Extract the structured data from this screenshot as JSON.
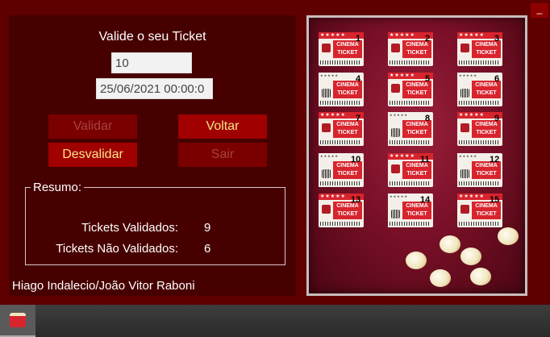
{
  "window": {
    "minimize_label": "_"
  },
  "form": {
    "title": "Valide o seu Ticket",
    "ticket_value": "10",
    "date_value": "25/06/2021 00:00:0"
  },
  "buttons": {
    "validar": "Validar",
    "voltar": "Voltar",
    "desvalidar": "Desvalidar",
    "sair": "Sair"
  },
  "resumo": {
    "legend": "Resumo:",
    "validados_label": "Tickets Validados:",
    "validados_value": "9",
    "nao_validados_label": "Tickets Não Validados:",
    "nao_validados_value": "6"
  },
  "authors": "Hiago Indalecio/João Vitor Raboni",
  "tickets": [
    {
      "num": "1",
      "head": "★★★★★",
      "body": "CINEMA TICKET"
    },
    {
      "num": "2",
      "head": "★★★★★",
      "body": "CINEMA TICKET"
    },
    {
      "num": "3",
      "head": "★★★★★",
      "body": "CINEMA TICKET"
    },
    {
      "num": "4",
      "head": "★★★★★",
      "body": "CINEMA TICKET"
    },
    {
      "num": "5",
      "head": "★★★★★",
      "body": "CINEMA TICKET"
    },
    {
      "num": "6",
      "head": "★★★★★",
      "body": "CINEMA TICKET"
    },
    {
      "num": "7",
      "head": "★★★★★",
      "body": "CINEMA TICKET"
    },
    {
      "num": "8",
      "head": "★★★★★",
      "body": "CINEMA TICKET"
    },
    {
      "num": "9",
      "head": "★★★★★",
      "body": "CINEMA TICKET"
    },
    {
      "num": "10",
      "head": "★★★★★",
      "body": "CINEMA TICKET"
    },
    {
      "num": "11",
      "head": "★★★★★",
      "body": "CINEMA TICKET"
    },
    {
      "num": "12",
      "head": "★★★★★",
      "body": "CINEMA TICKET"
    },
    {
      "num": "13",
      "head": "★★★★★",
      "body": "CINEMA TICKET"
    },
    {
      "num": "14",
      "head": "★★★★★",
      "body": "CINEMA TICKET"
    },
    {
      "num": "15",
      "head": "★★★★★",
      "body": "CINEMA TICKET"
    }
  ],
  "colors": {
    "window_bg": "#5e0000",
    "panel_bg": "#470000",
    "button_enabled": "#a00000",
    "button_text": "#f5e48a",
    "ticket_red": "#d8242d"
  }
}
